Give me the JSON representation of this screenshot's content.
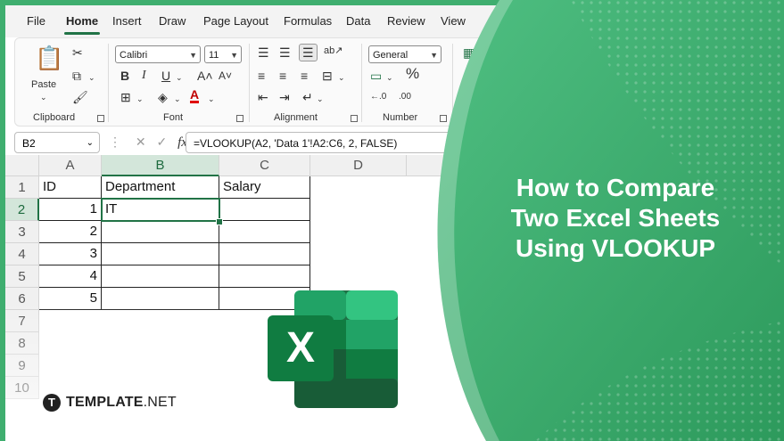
{
  "menu": {
    "tabs": [
      "File",
      "Home",
      "Insert",
      "Draw",
      "Page Layout",
      "Formulas",
      "Data",
      "Review",
      "View"
    ]
  },
  "ribbon": {
    "clipboard": {
      "paste_label": "Paste",
      "group_label": "Clipboard"
    },
    "font": {
      "font_name": "Calibri",
      "font_size": "11",
      "group_label": "Font"
    },
    "alignment": {
      "group_label": "Alignment"
    },
    "number": {
      "format": "General",
      "group_label": "Number"
    }
  },
  "formula_bar": {
    "name_box": "B2",
    "formula": "=VLOOKUP(A2, 'Data 1'!A2:C6, 2, FALSE)"
  },
  "sheet": {
    "columns": [
      "A",
      "B",
      "C",
      "D"
    ],
    "rows": [
      "1",
      "2",
      "3",
      "4",
      "5",
      "6",
      "7",
      "8",
      "9",
      "10"
    ],
    "header_row": [
      "ID",
      "Department",
      "Salary"
    ],
    "ids": [
      "1",
      "2",
      "3",
      "4",
      "5"
    ],
    "b2_value": "IT",
    "selected_column": "B",
    "selected_row": "2"
  },
  "promo": {
    "title_lines": [
      "How to Compare",
      "Two Excel Sheets",
      "Using VLOOKUP"
    ],
    "logo_letter": "X",
    "brand_bold": "TEMPLATE",
    "brand_thin": ".NET",
    "brand_mark": "T"
  },
  "colors": {
    "excel_green": "#217346",
    "panel_green": "#3fae6f",
    "ribbon_bg": "#fafafa"
  }
}
